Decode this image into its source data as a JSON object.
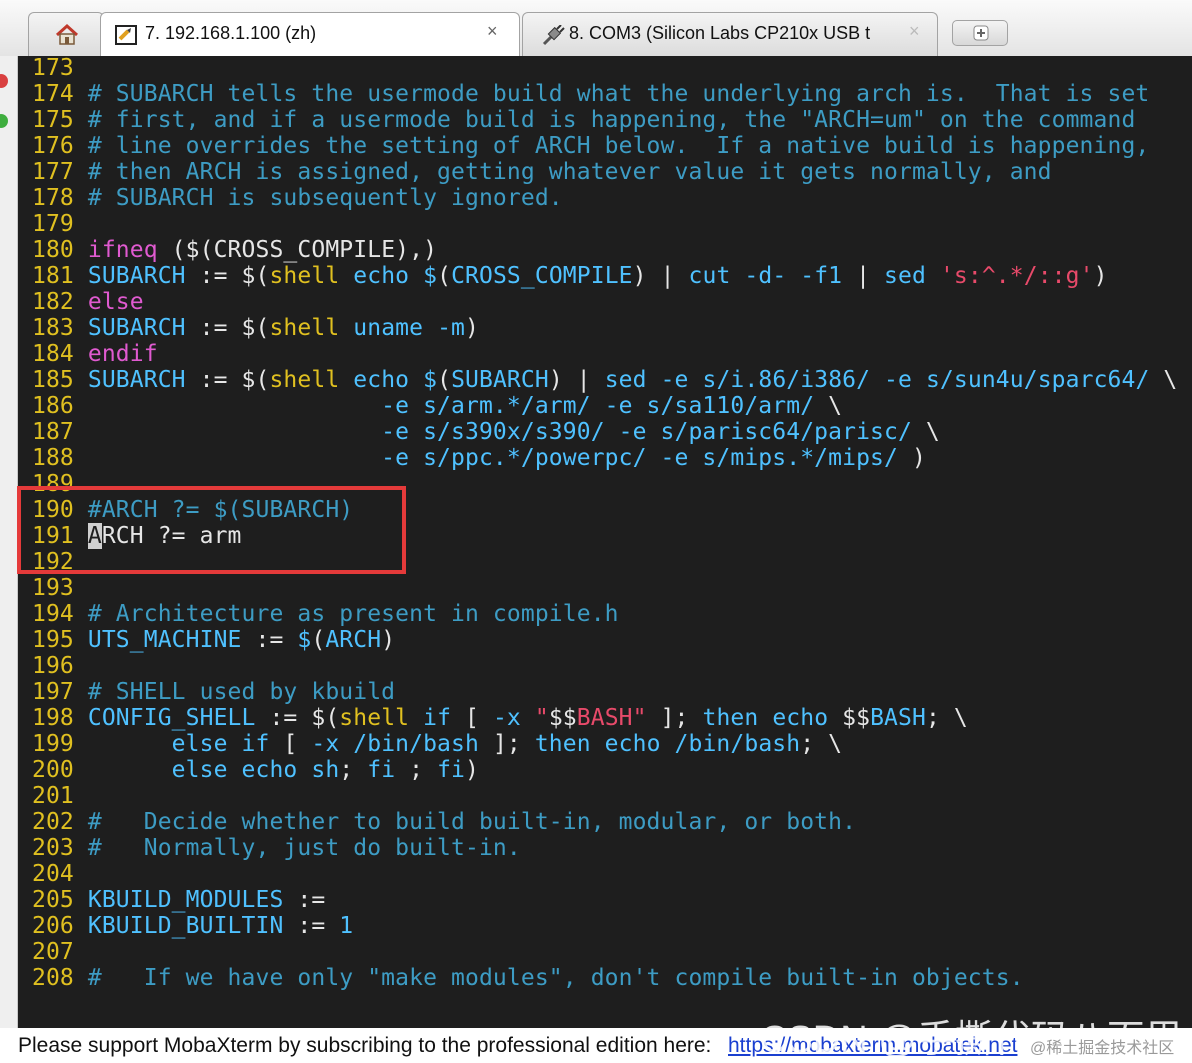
{
  "tabs": {
    "ssh_label": "7. 192.168.1.100 (zh)",
    "ssh_close": "×",
    "com_label": "8. COM3  (Silicon Labs CP210x USB t",
    "com_close": "×"
  },
  "colors": {
    "terminal_bg": "#1e1e1e",
    "line_number": "#e0c020",
    "comment": "#3d9cc4",
    "keyword": "#e05ad0",
    "identifier": "#4fc1ff",
    "string": "#e84a6a",
    "highlight_box": "#e53a3a",
    "link": "#1a3fd0"
  },
  "editor": {
    "cursor_line": "191",
    "lines": [
      {
        "n": "173",
        "t": ""
      },
      {
        "n": "174",
        "t": "# SUBARCH tells the usermode build what the underlying arch is.  That is set"
      },
      {
        "n": "175",
        "t": "# first, and if a usermode build is happening, the \"ARCH=um\" on the command"
      },
      {
        "n": "176",
        "t": "# line overrides the setting of ARCH below.  If a native build is happening,"
      },
      {
        "n": "177",
        "t": "# then ARCH is assigned, getting whatever value it gets normally, and"
      },
      {
        "n": "178",
        "t": "# SUBARCH is subsequently ignored."
      },
      {
        "n": "179",
        "t": ""
      },
      {
        "n": "180",
        "t": "ifneq ($(CROSS_COMPILE),)"
      },
      {
        "n": "181",
        "t": "SUBARCH := $(shell echo $(CROSS_COMPILE) | cut -d- -f1 | sed 's:^.*/::g')"
      },
      {
        "n": "182",
        "t": "else"
      },
      {
        "n": "183",
        "t": "SUBARCH := $(shell uname -m)"
      },
      {
        "n": "184",
        "t": "endif"
      },
      {
        "n": "185",
        "t": "SUBARCH := $(shell echo $(SUBARCH) | sed -e s/i.86/i386/ -e s/sun4u/sparc64/ \\"
      },
      {
        "n": "186",
        "t": "                     -e s/arm.*/arm/ -e s/sa110/arm/ \\"
      },
      {
        "n": "187",
        "t": "                     -e s/s390x/s390/ -e s/parisc64/parisc/ \\"
      },
      {
        "n": "188",
        "t": "                     -e s/ppc.*/powerpc/ -e s/mips.*/mips/ )"
      },
      {
        "n": "189",
        "t": ""
      },
      {
        "n": "190",
        "t": "#ARCH ?= $(SUBARCH)"
      },
      {
        "n": "191",
        "t": "ARCH ?= arm"
      },
      {
        "n": "192",
        "t": ""
      },
      {
        "n": "193",
        "t": ""
      },
      {
        "n": "194",
        "t": "# Architecture as present in compile.h"
      },
      {
        "n": "195",
        "t": "UTS_MACHINE := $(ARCH)"
      },
      {
        "n": "196",
        "t": ""
      },
      {
        "n": "197",
        "t": "# SHELL used by kbuild"
      },
      {
        "n": "198",
        "t": "CONFIG_SHELL := $(shell if [ -x \"$$BASH\" ]; then echo $$BASH; \\"
      },
      {
        "n": "199",
        "t": "      else if [ -x /bin/bash ]; then echo /bin/bash; \\"
      },
      {
        "n": "200",
        "t": "      else echo sh; fi ; fi)"
      },
      {
        "n": "201",
        "t": ""
      },
      {
        "n": "202",
        "t": "#   Decide whether to build built-in, modular, or both."
      },
      {
        "n": "203",
        "t": "#   Normally, just do built-in."
      },
      {
        "n": "204",
        "t": ""
      },
      {
        "n": "205",
        "t": "KBUILD_MODULES :="
      },
      {
        "n": "206",
        "t": "KBUILD_BUILTIN := 1"
      },
      {
        "n": "207",
        "t": ""
      },
      {
        "n": "208",
        "t": "#   If we have only \"make modules\", don't compile built-in objects."
      }
    ]
  },
  "status": {
    "message": "Please support MobaXterm by subscribing to the professional edition here:",
    "link": "https://mobaxterm.mobatek.net"
  },
  "watermark": {
    "csdn": "CSDN @手撕代码八百里",
    "juejin": "@稀土掘金技术社区"
  }
}
